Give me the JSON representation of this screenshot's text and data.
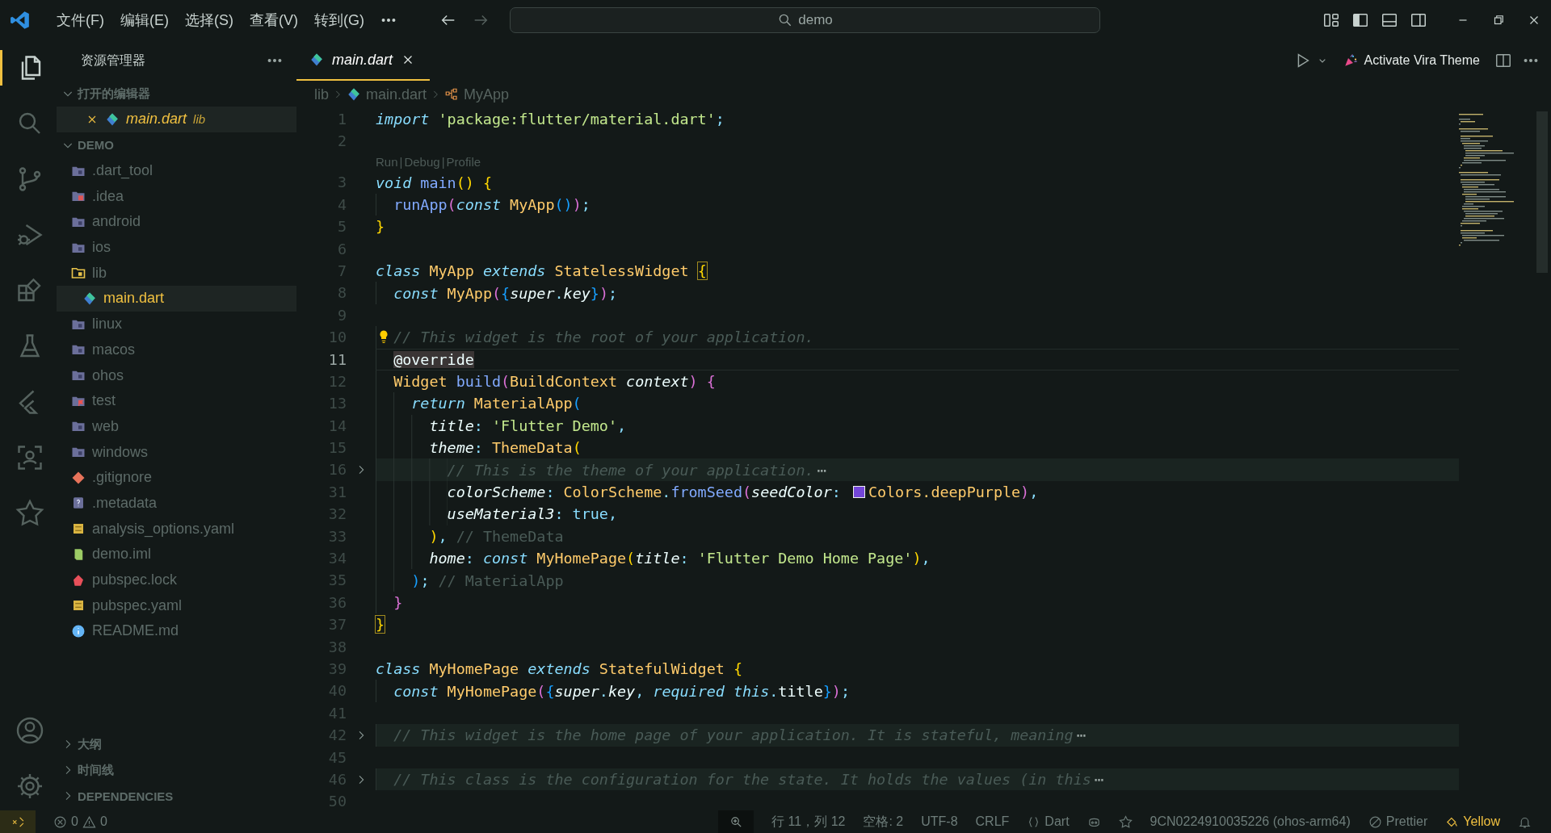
{
  "title_bar": {
    "menus": [
      "文件(F)",
      "编辑(E)",
      "选择(S)",
      "查看(V)",
      "转到(G)"
    ],
    "search": {
      "value": "demo"
    }
  },
  "activity_bar": {
    "top": [
      {
        "kind": "files",
        "selected": true
      },
      {
        "kind": "search",
        "selected": false
      },
      {
        "kind": "branch",
        "selected": false
      },
      {
        "kind": "debug",
        "selected": false
      },
      {
        "kind": "extensions",
        "selected": false
      },
      {
        "kind": "flask",
        "selected": false
      },
      {
        "kind": "flutter",
        "selected": false
      },
      {
        "kind": "scan",
        "selected": false
      },
      {
        "kind": "star",
        "selected": false
      }
    ],
    "bottom": [
      {
        "kind": "account",
        "selected": false
      },
      {
        "kind": "gear",
        "selected": false
      }
    ]
  },
  "sidebar": {
    "title": "资源管理器",
    "open_editors": {
      "title": "打开的编辑器",
      "expanded": true,
      "items": [
        {
          "name": "main.dart",
          "description": "lib",
          "selected": true
        }
      ]
    },
    "project": {
      "title": "DEMO",
      "expanded": true,
      "items": [
        {
          "name": ".dart_tool",
          "kind": "folder",
          "selected": false
        },
        {
          "name": ".idea",
          "kind": "folder-idea",
          "selected": false
        },
        {
          "name": "android",
          "kind": "folder",
          "selected": false
        },
        {
          "name": "ios",
          "kind": "folder",
          "selected": false
        },
        {
          "name": "lib",
          "kind": "folder-lib",
          "selected": false,
          "children": [
            {
              "name": "main.dart",
              "kind": "dart",
              "selected": true
            }
          ]
        },
        {
          "name": "linux",
          "kind": "folder",
          "selected": false
        },
        {
          "name": "macos",
          "kind": "folder",
          "selected": false
        },
        {
          "name": "ohos",
          "kind": "folder",
          "selected": false
        },
        {
          "name": "test",
          "kind": "folder-test",
          "selected": false
        },
        {
          "name": "web",
          "kind": "folder",
          "selected": false
        },
        {
          "name": "windows",
          "kind": "folder",
          "selected": false
        },
        {
          "name": ".gitignore",
          "kind": "git",
          "selected": false
        },
        {
          "name": ".metadata",
          "kind": "metadata",
          "selected": false
        },
        {
          "name": "analysis_options.yaml",
          "kind": "yaml",
          "selected": false
        },
        {
          "name": "demo.iml",
          "kind": "iml",
          "selected": false
        },
        {
          "name": "pubspec.lock",
          "kind": "lock",
          "selected": false
        },
        {
          "name": "pubspec.yaml",
          "kind": "yaml",
          "selected": false
        },
        {
          "name": "README.md",
          "kind": "info",
          "selected": false
        }
      ]
    },
    "bottom_sections": [
      {
        "title": "大纲",
        "expanded": false
      },
      {
        "title": "时间线",
        "expanded": false
      },
      {
        "title": "DEPENDENCIES",
        "expanded": false
      }
    ]
  },
  "editor": {
    "tabs": [
      {
        "name": "main.dart",
        "selected": true
      }
    ],
    "actions": {
      "theme_button": "Activate Vira Theme"
    },
    "breadcrumbs": [
      {
        "kind": "folder",
        "text": "lib"
      },
      {
        "kind": "dart",
        "text": "main.dart"
      },
      {
        "kind": "class",
        "text": "MyApp"
      }
    ],
    "lines": [
      {
        "kind": "code",
        "number": "1",
        "current": false,
        "folded": false,
        "lightbulb": false,
        "tokens": [
          {
            "kind": "kw",
            "text": "import"
          },
          {
            "kind": "str",
            "text": " 'package:flutter/material.dart'"
          },
          {
            "kind": "pun",
            "text": ";"
          }
        ]
      },
      {
        "kind": "code",
        "number": "2",
        "current": false,
        "folded": false,
        "lightbulb": false
      },
      {
        "kind": "codelens",
        "actions": [
          "Run",
          "Debug",
          "Profile"
        ],
        "separator": "|"
      },
      {
        "kind": "code",
        "number": "3",
        "current": false,
        "folded": false,
        "lightbulb": false,
        "tokens": [
          {
            "kind": "kw",
            "text": "void"
          },
          {
            "kind": "fn",
            "text": " main"
          },
          {
            "kind": "b1",
            "text": "()"
          },
          {
            "kind": "b1",
            "text": " {"
          }
        ]
      },
      {
        "kind": "code",
        "number": "4",
        "current": false,
        "folded": false,
        "lightbulb": false,
        "tokens": [
          {
            "kind": "fn",
            "text": "  runApp"
          },
          {
            "kind": "b2",
            "text": "("
          },
          {
            "kind": "kw",
            "text": "const"
          },
          {
            "kind": "cls",
            "text": " MyApp"
          },
          {
            "kind": "b3",
            "text": "()"
          },
          {
            "kind": "b2",
            "text": ")"
          },
          {
            "kind": "pun",
            "text": ";"
          }
        ]
      },
      {
        "kind": "code",
        "number": "5",
        "current": false,
        "folded": false,
        "lightbulb": false,
        "tokens": [
          {
            "kind": "b1",
            "text": "}"
          }
        ]
      },
      {
        "kind": "code",
        "number": "6",
        "current": false,
        "folded": false,
        "lightbulb": false
      },
      {
        "kind": "code",
        "number": "7",
        "current": false,
        "folded": false,
        "lightbulb": false,
        "tokens": [
          {
            "kind": "kw",
            "text": "class"
          },
          {
            "kind": "cls",
            "text": " MyApp"
          },
          {
            "kind": "kw",
            "text": " extends"
          },
          {
            "kind": "cls",
            "text": " StatelessWidget "
          },
          {
            "kind": "b1m",
            "text": "{"
          }
        ]
      },
      {
        "kind": "code",
        "number": "8",
        "current": false,
        "folded": false,
        "lightbulb": false,
        "tokens": [
          {
            "kind": "kw",
            "text": "  const"
          },
          {
            "kind": "cls",
            "text": " MyApp"
          },
          {
            "kind": "b2",
            "text": "("
          },
          {
            "kind": "b3",
            "text": "{"
          },
          {
            "kind": "prm",
            "text": "super"
          },
          {
            "kind": "pun",
            "text": "."
          },
          {
            "kind": "prm",
            "text": "key"
          },
          {
            "kind": "b3",
            "text": "}"
          },
          {
            "kind": "b2",
            "text": ")"
          },
          {
            "kind": "pun",
            "text": ";"
          }
        ]
      },
      {
        "kind": "code",
        "number": "9",
        "current": false,
        "folded": false,
        "lightbulb": false
      },
      {
        "kind": "code",
        "number": "10",
        "current": false,
        "folded": false,
        "lightbulb": true,
        "tokens": [
          {
            "kind": "cmt",
            "text": "  // This widget is the root of your application."
          }
        ]
      },
      {
        "kind": "code",
        "number": "11",
        "current": true,
        "folded": false,
        "lightbulb": false,
        "tokens": [
          {
            "kind": "hl",
            "text": "  @override"
          }
        ]
      },
      {
        "kind": "code",
        "number": "12",
        "current": false,
        "folded": false,
        "lightbulb": false,
        "tokens": [
          {
            "kind": "cls",
            "text": "  Widget"
          },
          {
            "kind": "fn",
            "text": " build"
          },
          {
            "kind": "b2",
            "text": "("
          },
          {
            "kind": "cls",
            "text": "BuildContext"
          },
          {
            "kind": "prm",
            "text": " context"
          },
          {
            "kind": "b2",
            "text": ")"
          },
          {
            "kind": "b2",
            "text": " {"
          }
        ]
      },
      {
        "kind": "code",
        "number": "13",
        "current": false,
        "folded": false,
        "lightbulb": false,
        "tokens": [
          {
            "kind": "kw",
            "text": "    return"
          },
          {
            "kind": "cls",
            "text": " MaterialApp"
          },
          {
            "kind": "b3",
            "text": "("
          }
        ]
      },
      {
        "kind": "code",
        "number": "14",
        "current": false,
        "folded": false,
        "lightbulb": false,
        "tokens": [
          {
            "kind": "prm",
            "text": "      title"
          },
          {
            "kind": "pun",
            "text": ":"
          },
          {
            "kind": "str",
            "text": " 'Flutter Demo'"
          },
          {
            "kind": "pun",
            "text": ","
          }
        ]
      },
      {
        "kind": "code",
        "number": "15",
        "current": false,
        "folded": false,
        "lightbulb": false,
        "tokens": [
          {
            "kind": "prm",
            "text": "      theme"
          },
          {
            "kind": "pun",
            "text": ":"
          },
          {
            "kind": "cls",
            "text": " ThemeData"
          },
          {
            "kind": "b1",
            "text": "("
          }
        ]
      },
      {
        "kind": "code",
        "number": "16",
        "current": false,
        "folded": true,
        "lightbulb": false,
        "tokens": [
          {
            "kind": "cmt",
            "text": "        // This is the theme of your application."
          },
          {
            "kind": "ell",
            "text": "⋯"
          }
        ]
      },
      {
        "kind": "code",
        "number": "31",
        "current": false,
        "folded": false,
        "lightbulb": false,
        "tokens": [
          {
            "kind": "prm",
            "text": "        colorScheme"
          },
          {
            "kind": "pun",
            "text": ":"
          },
          {
            "kind": "cls",
            "text": " ColorScheme"
          },
          {
            "kind": "pun",
            "text": "."
          },
          {
            "kind": "fn",
            "text": "fromSeed"
          },
          {
            "kind": "b2",
            "text": "("
          },
          {
            "kind": "prm",
            "text": "seedColor"
          },
          {
            "kind": "pun",
            "text": ": "
          },
          {
            "kind": "swatch",
            "color": "#7446d9"
          },
          {
            "kind": "cls",
            "text": "Colors.deepPurple"
          },
          {
            "kind": "b2",
            "text": ")"
          },
          {
            "kind": "pun",
            "text": ","
          }
        ]
      },
      {
        "kind": "code",
        "number": "32",
        "current": false,
        "folded": false,
        "lightbulb": false,
        "tokens": [
          {
            "kind": "prm",
            "text": "        useMaterial3"
          },
          {
            "kind": "pun",
            "text": ":"
          },
          {
            "kind": "lit",
            "text": " true"
          },
          {
            "kind": "pun",
            "text": ","
          }
        ]
      },
      {
        "kind": "code",
        "number": "33",
        "current": false,
        "folded": false,
        "lightbulb": false,
        "tokens": [
          {
            "kind": "b1",
            "text": "      )"
          },
          {
            "kind": "pun",
            "text": ","
          },
          {
            "kind": "cmt2",
            "text": " // ThemeData"
          }
        ]
      },
      {
        "kind": "code",
        "number": "34",
        "current": false,
        "folded": false,
        "lightbulb": false,
        "tokens": [
          {
            "kind": "prm",
            "text": "      home"
          },
          {
            "kind": "pun",
            "text": ":"
          },
          {
            "kind": "kw",
            "text": " const"
          },
          {
            "kind": "cls",
            "text": " MyHomePage"
          },
          {
            "kind": "b1",
            "text": "("
          },
          {
            "kind": "prm",
            "text": "title"
          },
          {
            "kind": "pun",
            "text": ":"
          },
          {
            "kind": "str",
            "text": " 'Flutter Demo Home Page'"
          },
          {
            "kind": "b1",
            "text": ")"
          },
          {
            "kind": "pun",
            "text": ","
          }
        ]
      },
      {
        "kind": "code",
        "number": "35",
        "current": false,
        "folded": false,
        "lightbulb": false,
        "tokens": [
          {
            "kind": "b3",
            "text": "    )"
          },
          {
            "kind": "pun",
            "text": ";"
          },
          {
            "kind": "cmt2",
            "text": " // MaterialApp"
          }
        ]
      },
      {
        "kind": "code",
        "number": "36",
        "current": false,
        "folded": false,
        "lightbulb": false,
        "tokens": [
          {
            "kind": "b2",
            "text": "  }"
          }
        ]
      },
      {
        "kind": "code",
        "number": "37",
        "current": false,
        "folded": false,
        "lightbulb": false,
        "tokens": [
          {
            "kind": "b1m",
            "text": "}"
          }
        ]
      },
      {
        "kind": "code",
        "number": "38",
        "current": false,
        "folded": false,
        "lightbulb": false
      },
      {
        "kind": "code",
        "number": "39",
        "current": false,
        "folded": false,
        "lightbulb": false,
        "tokens": [
          {
            "kind": "kw",
            "text": "class"
          },
          {
            "kind": "cls",
            "text": " MyHomePage"
          },
          {
            "kind": "kw",
            "text": " extends"
          },
          {
            "kind": "cls",
            "text": " StatefulWidget"
          },
          {
            "kind": "b1",
            "text": " {"
          }
        ]
      },
      {
        "kind": "code",
        "number": "40",
        "current": false,
        "folded": false,
        "lightbulb": false,
        "tokens": [
          {
            "kind": "kw",
            "text": "  const"
          },
          {
            "kind": "cls",
            "text": " MyHomePage"
          },
          {
            "kind": "b2",
            "text": "("
          },
          {
            "kind": "b3",
            "text": "{"
          },
          {
            "kind": "prm",
            "text": "super"
          },
          {
            "kind": "pun",
            "text": "."
          },
          {
            "kind": "prm",
            "text": "key"
          },
          {
            "kind": "pun",
            "text": ","
          },
          {
            "kind": "kw",
            "text": " required"
          },
          {
            "kind": "kw",
            "text": " this"
          },
          {
            "kind": "pun",
            "text": "."
          },
          {
            "kind": "txt",
            "text": "title"
          },
          {
            "kind": "b3",
            "text": "}"
          },
          {
            "kind": "b2",
            "text": ")"
          },
          {
            "kind": "pun",
            "text": ";"
          }
        ]
      },
      {
        "kind": "code",
        "number": "41",
        "current": false,
        "folded": false,
        "lightbulb": false
      },
      {
        "kind": "code",
        "number": "42",
        "current": false,
        "folded": true,
        "lightbulb": false,
        "tokens": [
          {
            "kind": "cmt",
            "text": "  // This widget is the home page of your application. It is stateful, meaning"
          },
          {
            "kind": "ell",
            "text": "⋯"
          }
        ]
      },
      {
        "kind": "code",
        "number": "45",
        "current": false,
        "folded": false,
        "lightbulb": false
      },
      {
        "kind": "code",
        "number": "46",
        "current": false,
        "folded": true,
        "lightbulb": false,
        "tokens": [
          {
            "kind": "cmt",
            "text": "  // This class is the configuration for the state. It holds the values (in this"
          },
          {
            "kind": "ell",
            "text": "⋯"
          }
        ]
      },
      {
        "kind": "code",
        "number": "50",
        "current": false,
        "folded": false,
        "lightbulb": false
      }
    ]
  },
  "status_bar": {
    "errors": "0",
    "warnings": "0",
    "position": "行 11，列 12",
    "indentation": "空格: 2",
    "encoding": "UTF-8",
    "line_ending": "CRLF",
    "language": "Dart",
    "device": "9CN0224910035226 (ohos-arm64)",
    "formatter": "Prettier",
    "theme": "Yellow"
  }
}
